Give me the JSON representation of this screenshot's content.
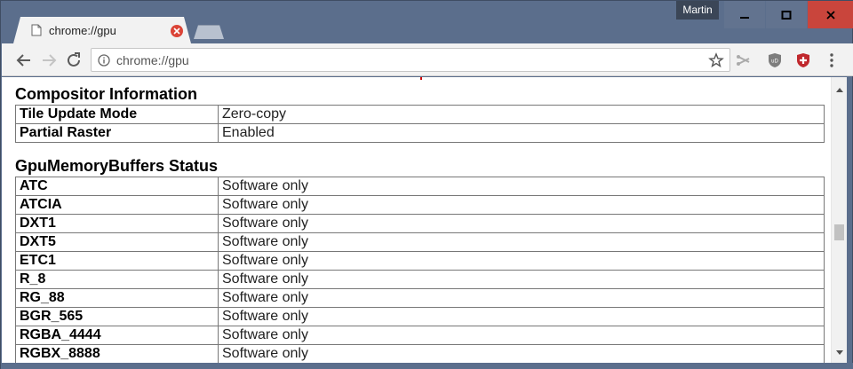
{
  "window": {
    "profile_name": "Martin",
    "tab": {
      "title": "chrome://gpu",
      "favicon": "page-icon"
    },
    "controls": {
      "minimize": "minimize-icon",
      "maximize": "maximize-icon",
      "close": "close-icon"
    }
  },
  "toolbar": {
    "url": "chrome://gpu",
    "icons": [
      "back-arrow-icon",
      "forward-arrow-icon",
      "reload-icon",
      "info-icon",
      "star-icon",
      "scissors-icon",
      "ublock-icon",
      "shield-extension-icon",
      "menu-dots-icon"
    ]
  },
  "compositor": {
    "title": "Compositor Information",
    "rows": [
      {
        "key": "Tile Update Mode",
        "value": "Zero-copy"
      },
      {
        "key": "Partial Raster",
        "value": "Enabled"
      }
    ]
  },
  "gpu_memory": {
    "title": "GpuMemoryBuffers Status",
    "rows": [
      {
        "key": "ATC",
        "value": "Software only"
      },
      {
        "key": "ATCIA",
        "value": "Software only"
      },
      {
        "key": "DXT1",
        "value": "Software only"
      },
      {
        "key": "DXT5",
        "value": "Software only"
      },
      {
        "key": "ETC1",
        "value": "Software only"
      },
      {
        "key": "R_8",
        "value": "Software only"
      },
      {
        "key": "RG_88",
        "value": "Software only"
      },
      {
        "key": "BGR_565",
        "value": "Software only"
      },
      {
        "key": "RGBA_4444",
        "value": "Software only"
      },
      {
        "key": "RGBX_8888",
        "value": "Software only"
      }
    ]
  },
  "colors": {
    "frame": "#5b6e8c",
    "close_button": "#c9453c",
    "tab_close": "#db4437",
    "ublock_shield": "#c0282d"
  }
}
